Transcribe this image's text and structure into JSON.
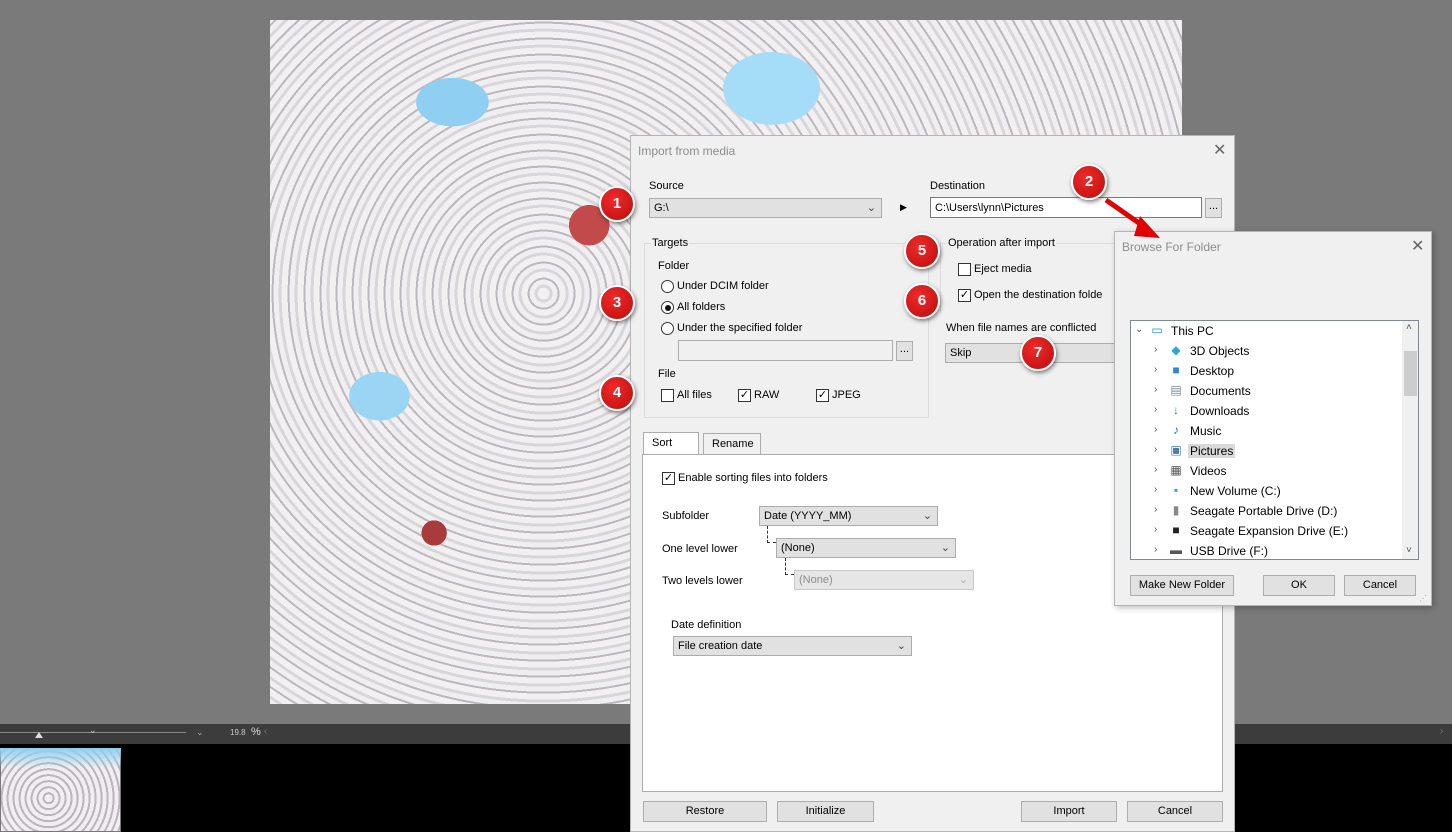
{
  "viewer": {
    "zoom_value": "19.8",
    "zoom_unit": "%"
  },
  "import_dialog": {
    "title": "Import from media",
    "source_label": "Source",
    "source_value": "G:\\",
    "destination_label": "Destination",
    "destination_value": "C:\\Users\\lynn\\Pictures",
    "browse_label": "...",
    "targets": {
      "group_label": "Targets",
      "folder_label": "Folder",
      "radio_dcim": "Under DCIM folder",
      "radio_all": "All folders",
      "radio_specified": "Under the specified folder",
      "selected": "All folders",
      "specified_path": "",
      "file_label": "File",
      "checkbox_all_files": "All files",
      "checkbox_raw": "RAW",
      "checkbox_jpeg": "JPEG"
    },
    "operation": {
      "group_label": "Operation after import",
      "eject_label": "Eject media",
      "open_dest_label": "Open the destination folde",
      "conflict_label": "When file names are conflicted",
      "conflict_value": "Skip"
    },
    "tabs": [
      "Sort",
      "Rename"
    ],
    "sort": {
      "enable_label": "Enable sorting files into folders",
      "subfolder_label": "Subfolder",
      "subfolder_value": "Date (YYYY_MM)",
      "one_level_label": "One level lower",
      "one_level_value": "(None)",
      "two_levels_label": "Two levels lower",
      "two_levels_value": "(None)",
      "date_def_label": "Date definition",
      "date_def_value": "File creation date"
    },
    "buttons": {
      "restore": "Restore",
      "initialize": "Initialize",
      "import": "Import",
      "cancel": "Cancel"
    }
  },
  "browse_dialog": {
    "title": "Browse For Folder",
    "tree": [
      {
        "label": "This PC",
        "icon": "monitor-icon"
      },
      {
        "label": "3D Objects",
        "icon": "cube-icon"
      },
      {
        "label": "Desktop",
        "icon": "desktop-icon"
      },
      {
        "label": "Documents",
        "icon": "documents-icon"
      },
      {
        "label": "Downloads",
        "icon": "download-icon"
      },
      {
        "label": "Music",
        "icon": "music-note-icon"
      },
      {
        "label": "Pictures",
        "icon": "pictures-icon"
      },
      {
        "label": "Videos",
        "icon": "film-icon"
      },
      {
        "label": "New Volume (C:)",
        "icon": "system-drive-icon"
      },
      {
        "label": "Seagate Portable Drive (D:)",
        "icon": "drive-icon"
      },
      {
        "label": "Seagate Expansion Drive (E:)",
        "icon": "drive-icon"
      },
      {
        "label": "USB Drive (F:)",
        "icon": "usb-drive-icon"
      }
    ],
    "selected": "Pictures",
    "make_new_folder": "Make New Folder",
    "ok": "OK",
    "cancel": "Cancel"
  },
  "badges": [
    "1",
    "2",
    "3",
    "4",
    "5",
    "6",
    "7"
  ],
  "colors": {
    "badge_red": "#d81b1b",
    "arrow_red": "#e00000",
    "dialog_bg": "#f0f0f0",
    "selection_bg": "#d9d9d9"
  }
}
